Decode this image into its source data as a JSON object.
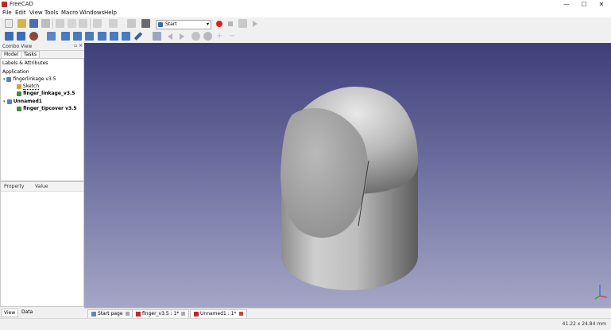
{
  "window": {
    "title": "FreeCAD",
    "controls": [
      "—",
      "☐",
      "✕"
    ]
  },
  "menu": [
    "File",
    "Edit",
    "View",
    "Tools",
    "Macro",
    "Windows",
    "Help"
  ],
  "toolbar": {
    "workbench": "Start"
  },
  "combo_view": {
    "title": "Combo View",
    "tabs": [
      "Model",
      "Tasks"
    ],
    "tree_header": "Labels & Attributes",
    "application_label": "Application",
    "documents": [
      {
        "name": "fingerlinkage v3.5",
        "children": [
          "Sketch",
          "finger_linkage_v3.5"
        ]
      },
      {
        "name": "Unnamed1",
        "children": [
          "finger_tipcover v3.5"
        ]
      }
    ],
    "property_columns": [
      "Property",
      "Value"
    ],
    "bottom_tabs": [
      "View",
      "Data"
    ]
  },
  "doc_tabs": [
    {
      "label": "Start page",
      "active": false
    },
    {
      "label": "finger_v3.5 : 1*",
      "active": false
    },
    {
      "label": "Unnamed1 : 1*",
      "active": true
    }
  ],
  "status": {
    "dimensions": "41.22 x 24.84 mm"
  },
  "colors": {
    "view_top": "#3e3f7a",
    "view_bottom": "#a5a6c6",
    "record": "#e02020"
  }
}
